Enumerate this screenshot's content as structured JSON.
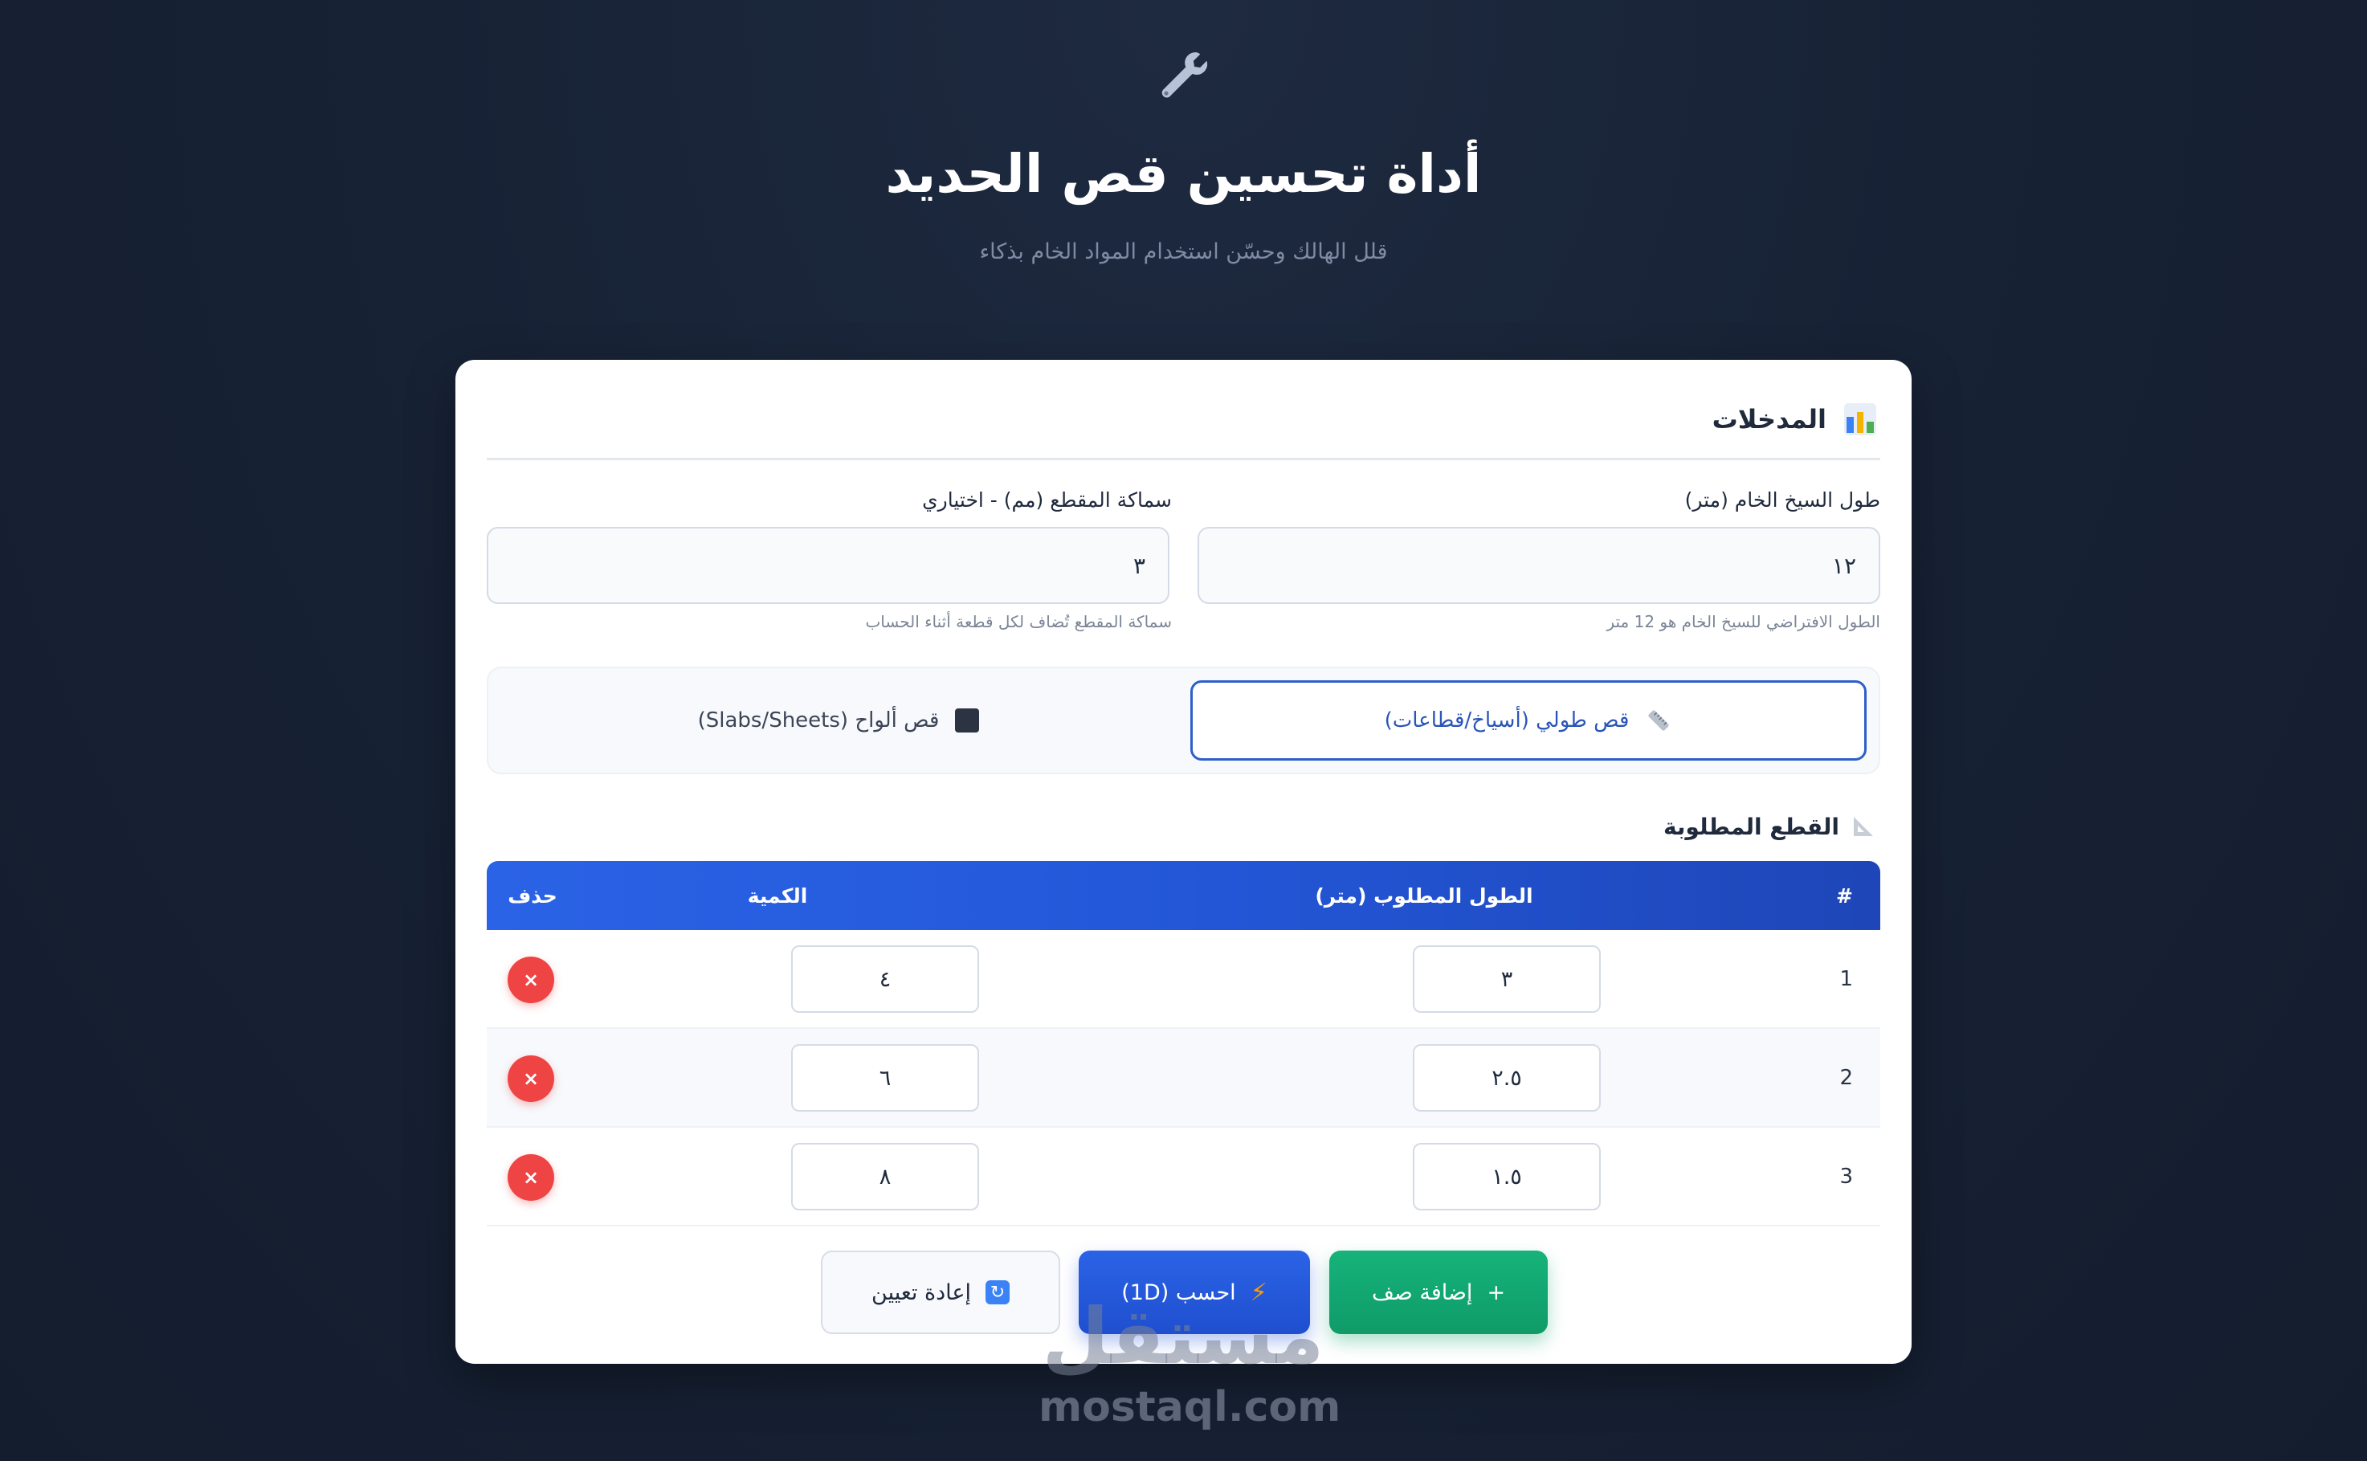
{
  "header": {
    "icon": "wrench-icon",
    "title": "أداة تحسين قص الحديد",
    "subtitle": "قلل الهالك وحسّن استخدام المواد الخام بذكاء"
  },
  "inputs": {
    "section_title": "المدخلات",
    "section_icon": "bar-chart-icon",
    "raw_length": {
      "label": "طول السيخ الخام (متر)",
      "value": "١٢",
      "hint": "الطول الافتراضي للسيخ الخام هو 12 متر"
    },
    "kerf": {
      "label": "سماكة المقطع (مم) - اختياري",
      "value": "٣",
      "hint": "سماكة المقطع تُضاف لكل قطعة أثناء الحساب"
    }
  },
  "modes": {
    "linear": {
      "label": "قص طولي (أسياخ/قطاعات)",
      "icon": "ruler-icon",
      "active": true
    },
    "sheets": {
      "label": "قص ألواح (Slabs/Sheets)",
      "icon": "square-icon",
      "active": false
    }
  },
  "pieces": {
    "title": "القطع المطلوبة",
    "icon": "triangle-ruler-icon",
    "columns": {
      "index": "#",
      "length": "الطول المطلوب (متر)",
      "qty": "الكمية",
      "delete": "حذف"
    },
    "rows": [
      {
        "index": "1",
        "length": "٣",
        "qty": "٤"
      },
      {
        "index": "2",
        "length": "٢.٥",
        "qty": "٦"
      },
      {
        "index": "3",
        "length": "١.٥",
        "qty": "٨"
      }
    ],
    "delete_symbol": "×"
  },
  "actions": {
    "add_row": {
      "label": "إضافة صف",
      "icon": "+"
    },
    "calculate": {
      "label": "احسب (1D)",
      "icon": "⚡"
    },
    "reset": {
      "label": "إعادة تعيين",
      "icon": "🔄"
    }
  },
  "watermark": {
    "arabic": "مستقل",
    "english": "mostaql.com"
  },
  "colors": {
    "background": "#162033",
    "primary": "#2b63e6",
    "success": "#10a56e",
    "danger": "#ef4444"
  }
}
